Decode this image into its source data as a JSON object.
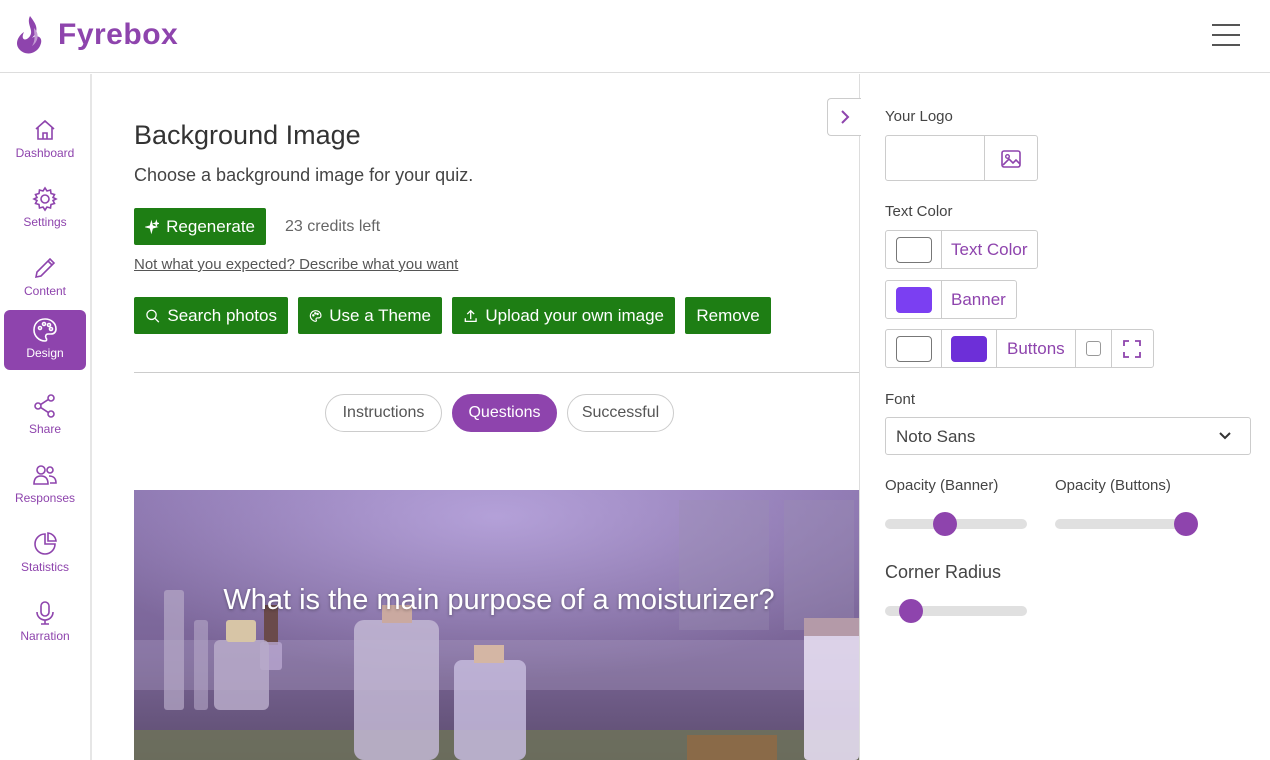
{
  "app": {
    "name": "Fyrebox"
  },
  "sidebar": {
    "items": [
      {
        "label": "Dashboard",
        "icon": "home-icon",
        "active": false
      },
      {
        "label": "Settings",
        "icon": "gear-icon",
        "active": false
      },
      {
        "label": "Content",
        "icon": "pencil-icon",
        "active": false
      },
      {
        "label": "Design",
        "icon": "palette-icon",
        "active": true
      },
      {
        "label": "Share",
        "icon": "share-icon",
        "active": false
      },
      {
        "label": "Responses",
        "icon": "users-icon",
        "active": false
      },
      {
        "label": "Statistics",
        "icon": "pie-chart-icon",
        "active": false
      },
      {
        "label": "Narration",
        "icon": "microphone-icon",
        "active": false
      }
    ]
  },
  "main": {
    "title": "Background Image",
    "subtitle": "Choose a background image for your quiz.",
    "regenerate_label": "Regenerate",
    "credits_text": "23 credits left",
    "describe_link": "Not what you expected? Describe what you want",
    "actions": {
      "search": "Search photos",
      "theme": "Use a Theme",
      "upload": "Upload your own image",
      "remove": "Remove"
    },
    "tabs": [
      {
        "label": "Instructions",
        "active": false
      },
      {
        "label": "Questions",
        "active": true
      },
      {
        "label": "Successful",
        "active": false
      }
    ],
    "preview_question": "What is the main purpose of a moisturizer?"
  },
  "panel": {
    "logo_label": "Your Logo",
    "text_color_label": "Text Color",
    "text_color_button": "Text Color",
    "banner_button": "Banner",
    "buttons_button": "Buttons",
    "font_label": "Font",
    "font_value": "Noto Sans",
    "opacity_banner_label": "Opacity (Banner)",
    "opacity_buttons_label": "Opacity (Buttons)",
    "corner_radius_label": "Corner Radius",
    "opacity_banner_value": 0.42,
    "opacity_buttons_value": 0.92,
    "corner_radius_value": 0.18
  },
  "colors": {
    "brand": "#8e44ad",
    "green": "#1e7e14",
    "text_color": "#ffffff",
    "banner_color": "#7b3ff2",
    "buttons_bg": "#ffffff",
    "buttons_text": "#6d2fd8"
  }
}
